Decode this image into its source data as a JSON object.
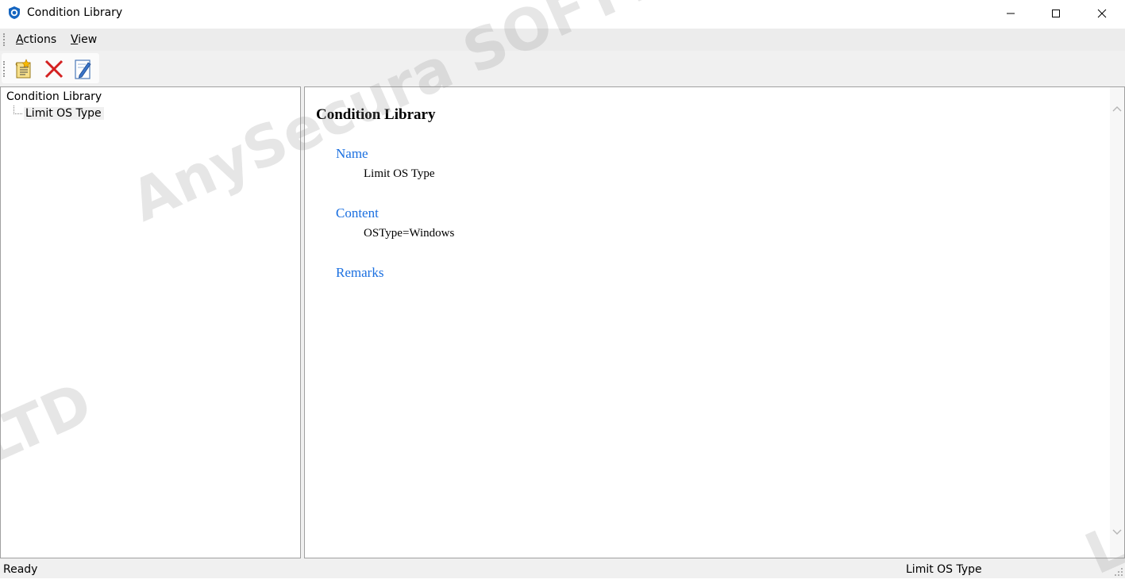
{
  "window": {
    "title": "Condition Library",
    "controls": {
      "minimize": "minimize",
      "maximize": "maximize",
      "close": "close"
    }
  },
  "menu": {
    "items": [
      {
        "accel": "A",
        "rest": "ctions"
      },
      {
        "accel": "V",
        "rest": "iew"
      }
    ]
  },
  "toolbar": {
    "buttons": [
      {
        "icon": "new-condition-icon"
      },
      {
        "icon": "delete-icon",
        "color": "#d42020"
      },
      {
        "icon": "edit-icon"
      }
    ]
  },
  "tree": {
    "root": "Condition Library",
    "children": [
      {
        "label": "Limit OS Type",
        "selected": true
      }
    ]
  },
  "detail": {
    "title": "Condition Library",
    "fields": [
      {
        "label": "Name",
        "value": "Limit OS Type"
      },
      {
        "label": "Content",
        "value": "OSType=Windows"
      },
      {
        "label": "Remarks",
        "value": ""
      }
    ],
    "label_color": "#1a6fe0"
  },
  "status": {
    "left": "Ready",
    "right": "Limit OS Type"
  },
  "watermark": {
    "main": "AnySecura SOFTWARE PTE. LTD",
    "left": "LTD",
    "right": "L"
  }
}
